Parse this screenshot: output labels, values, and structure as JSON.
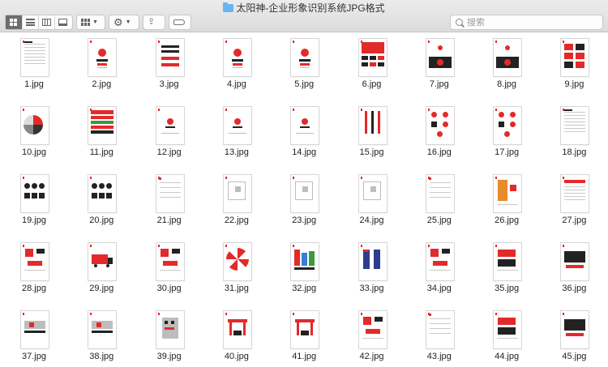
{
  "window": {
    "title": "太阳神-企业形象识别系统JPG格式",
    "folder_icon": "folder-icon"
  },
  "toolbar": {
    "view_modes": [
      "icon-view",
      "list-view",
      "column-view",
      "gallery-view"
    ],
    "active_view": "icon-view",
    "group_icon": "group-grid-icon",
    "action_icon": "gear-icon",
    "share_icon": "share-icon",
    "tag_icon": "tag-icon"
  },
  "search": {
    "placeholder": "搜索",
    "value": ""
  },
  "colors": {
    "accent_red": "#e32a2a",
    "dark": "#222222",
    "toolbar_active": "#6d6d6d"
  },
  "files": [
    {
      "name": "1.jpg",
      "style": "doc"
    },
    {
      "name": "2.jpg",
      "style": "logo"
    },
    {
      "name": "3.jpg",
      "style": "type"
    },
    {
      "name": "4.jpg",
      "style": "logo"
    },
    {
      "name": "5.jpg",
      "style": "logo"
    },
    {
      "name": "6.jpg",
      "style": "redblock"
    },
    {
      "name": "7.jpg",
      "style": "darklogo"
    },
    {
      "name": "8.jpg",
      "style": "darklogo"
    },
    {
      "name": "9.jpg",
      "style": "tiles"
    },
    {
      "name": "10.jpg",
      "style": "wheel"
    },
    {
      "name": "11.jpg",
      "style": "stripes"
    },
    {
      "name": "12.jpg",
      "style": "logosmall"
    },
    {
      "name": "13.jpg",
      "style": "logosmall"
    },
    {
      "name": "14.jpg",
      "style": "logosmall"
    },
    {
      "name": "15.jpg",
      "style": "bars"
    },
    {
      "name": "16.jpg",
      "style": "multilogo"
    },
    {
      "name": "17.jpg",
      "style": "multilogo"
    },
    {
      "name": "18.jpg",
      "style": "doc"
    },
    {
      "name": "19.jpg",
      "style": "icons"
    },
    {
      "name": "20.jpg",
      "style": "icons"
    },
    {
      "name": "21.jpg",
      "style": "lines"
    },
    {
      "name": "22.jpg",
      "style": "plan"
    },
    {
      "name": "23.jpg",
      "style": "plan"
    },
    {
      "name": "24.jpg",
      "style": "plan"
    },
    {
      "name": "25.jpg",
      "style": "lines"
    },
    {
      "name": "26.jpg",
      "style": "orange"
    },
    {
      "name": "27.jpg",
      "style": "redlines"
    },
    {
      "name": "28.jpg",
      "style": "mixed"
    },
    {
      "name": "29.jpg",
      "style": "truck"
    },
    {
      "name": "30.jpg",
      "style": "mixed"
    },
    {
      "name": "31.jpg",
      "style": "umbrella"
    },
    {
      "name": "32.jpg",
      "style": "colorful"
    },
    {
      "name": "33.jpg",
      "style": "uniform"
    },
    {
      "name": "34.jpg",
      "style": "mixed"
    },
    {
      "name": "35.jpg",
      "style": "cards"
    },
    {
      "name": "36.jpg",
      "style": "photo"
    },
    {
      "name": "37.jpg",
      "style": "sign"
    },
    {
      "name": "38.jpg",
      "style": "sign"
    },
    {
      "name": "39.jpg",
      "style": "building"
    },
    {
      "name": "40.jpg",
      "style": "gate"
    },
    {
      "name": "41.jpg",
      "style": "gate"
    },
    {
      "name": "42.jpg",
      "style": "mixed"
    },
    {
      "name": "43.jpg",
      "style": "lines"
    },
    {
      "name": "44.jpg",
      "style": "cards"
    },
    {
      "name": "45.jpg",
      "style": "photo"
    }
  ]
}
